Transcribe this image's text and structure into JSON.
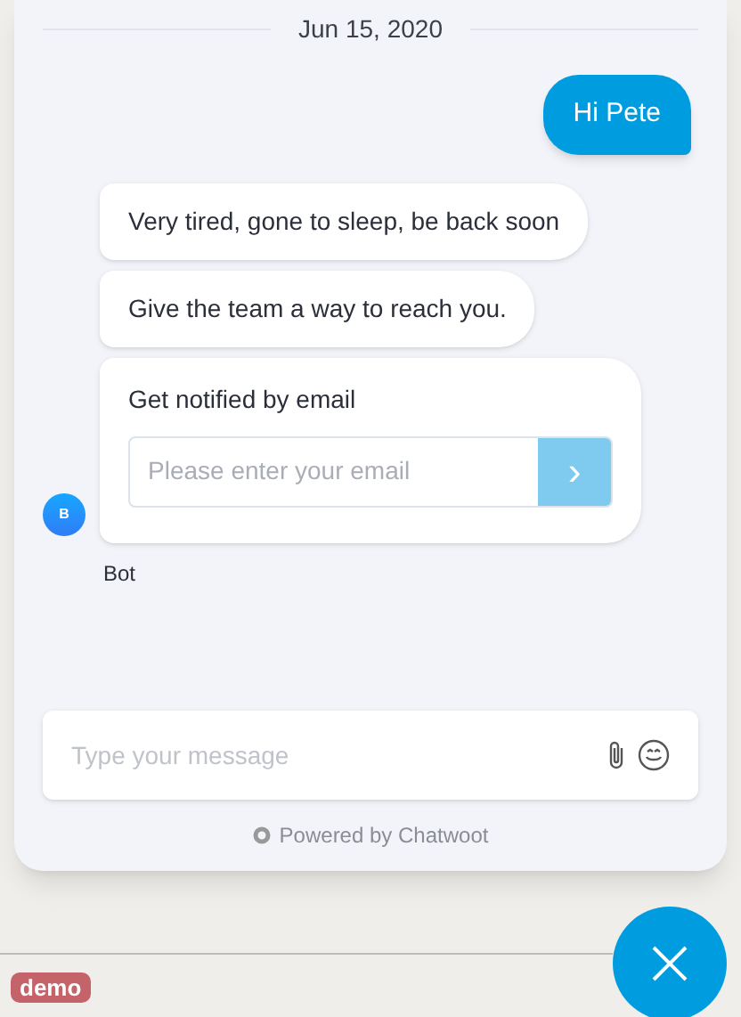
{
  "date_separator": "Jun 15, 2020",
  "messages": [
    {
      "kind": "user",
      "text": "Hi Pete"
    },
    {
      "kind": "bot",
      "text": "Very tired, gone to sleep, be back soon"
    },
    {
      "kind": "bot",
      "text": "Give the team a way to reach you."
    },
    {
      "kind": "email_form",
      "title": "Get notified by email",
      "placeholder": "Please enter your email",
      "submit": "›"
    }
  ],
  "avatar": {
    "initial": "B",
    "name": "Bot"
  },
  "composer": {
    "placeholder": "Type your message"
  },
  "branding": "Powered by Chatwoot",
  "page_badge": "demo"
}
